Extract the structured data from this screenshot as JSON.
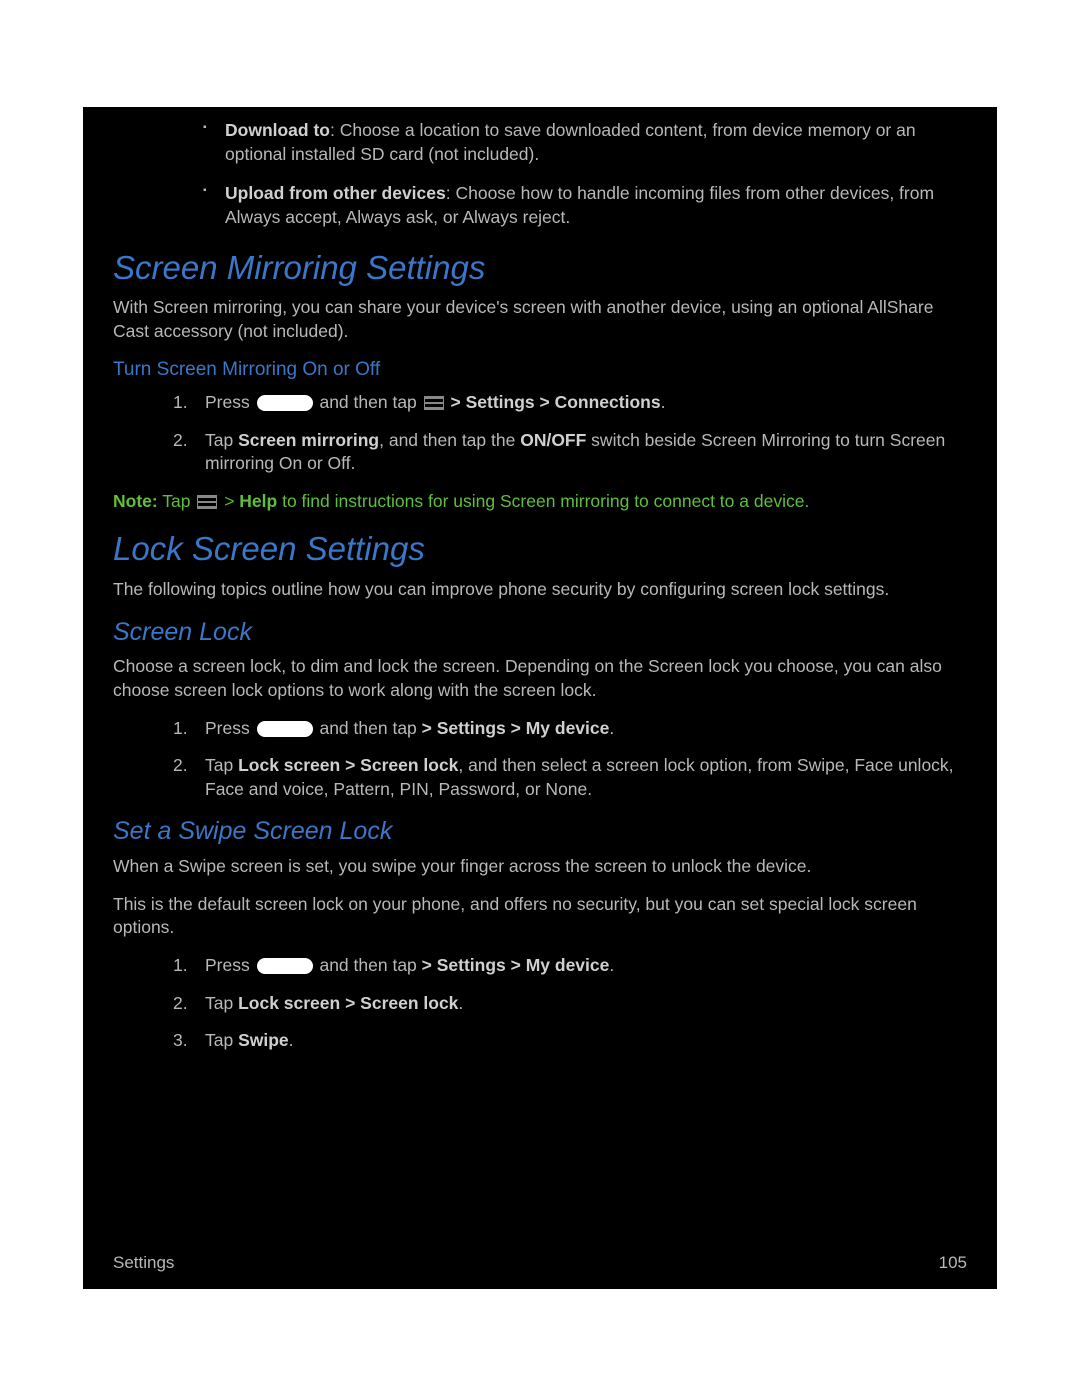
{
  "bullets": [
    {
      "strong": "Download to",
      "text": ": Choose a location to save downloaded content, from device memory or an optional installed SD card (not included)."
    },
    {
      "strong": "Upload from other devices",
      "text": ": Choose how to handle incoming files from other devices, from Always accept, Always ask, or Always reject."
    }
  ],
  "screenMirror": {
    "heading": "Screen Mirroring Settings",
    "intro": "With Screen mirroring, you can share your device's screen with another device, using an optional AllShare Cast accessory (not included).",
    "sub": "Turn Screen Mirroring On or Off",
    "step1_press": "Press ",
    "step1_tap": " and then tap ",
    "step1_path": " > Settings > Connections",
    "step1_end": ".",
    "step2_a": "Tap ",
    "step2_b": "Screen mirroring",
    "step2_c": ", and then tap the ",
    "step2_d": "ON/OFF",
    "step2_e": " switch beside Screen Mirroring to turn Screen mirroring On or Off."
  },
  "note": {
    "label": "Note:",
    "a": " Tap ",
    "b": " > ",
    "help": "Help",
    "c": " to find instructions for using Screen mirroring to connect to a device."
  },
  "lockScreen": {
    "heading": "Lock Screen Settings",
    "intro": "The following topics outline how you can improve phone security by configuring screen lock settings."
  },
  "screenLock": {
    "heading": "Screen Lock",
    "intro": "Choose a screen lock, to dim and lock the screen. Depending on the Screen lock you choose, you can also choose screen lock options to work along with the screen lock.",
    "step1_press": "Press ",
    "step1_tap": " and then tap ",
    "step1_gap": "     ",
    "step1_path": " > Settings > My device",
    "step1_end": ".",
    "step2_a": "Tap ",
    "step2_b": "Lock screen > Screen lock",
    "step2_c": ", and then select a screen lock option, from Swipe, Face unlock, Face and voice, Pattern, PIN, Password, or None."
  },
  "swipe": {
    "heading": "Set a Swipe Screen Lock",
    "p1": "When a Swipe screen is set, you swipe your finger across the screen to unlock the device.",
    "p2": "This is the default screen lock on your phone, and offers no security, but you can set special lock screen options.",
    "step1_press": "Press ",
    "step1_tap": " and then tap ",
    "step1_gap": "     ",
    "step1_path": " > Settings > My device",
    "step1_end": ".",
    "step2_a": "Tap ",
    "step2_b": "Lock screen > Screen lock",
    "step2_c": ".",
    "step3_a": "Tap ",
    "step3_b": "Swipe",
    "step3_c": "."
  },
  "footer": {
    "section": "Settings",
    "page": "105"
  }
}
